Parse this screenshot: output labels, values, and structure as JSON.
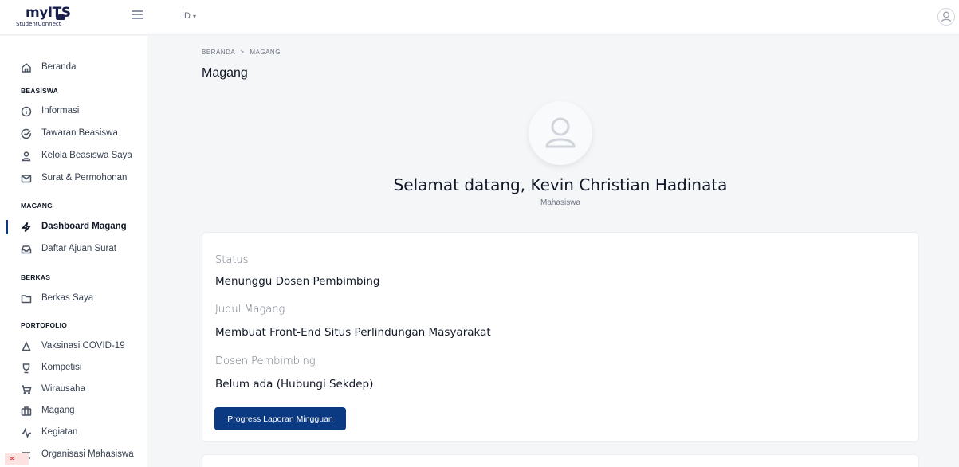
{
  "brand": {
    "name": "myITS",
    "subtitle": "StudentConnect"
  },
  "topbar": {
    "language": "ID",
    "language_caret": "▾"
  },
  "sidebar": {
    "home": {
      "label": "Beranda",
      "icon": "home-icon"
    },
    "sections": {
      "beasiswa": "BEASISWA",
      "magang": "MAGANG",
      "berkas": "BERKAS",
      "portofolio": "PORTOFOLIO"
    },
    "beasiswa_items": [
      {
        "label": "Informasi",
        "icon": "info-icon"
      },
      {
        "label": "Tawaran Beasiswa",
        "icon": "check-circle-icon"
      },
      {
        "label": "Kelola Beasiswa Saya",
        "icon": "user-icon"
      },
      {
        "label": "Surat & Permohonan",
        "icon": "mail-icon"
      }
    ],
    "magang_items": [
      {
        "label": "Dashboard Magang",
        "icon": "lightning-icon",
        "active": true
      },
      {
        "label": "Daftar Ajuan Surat",
        "icon": "inbox-icon"
      }
    ],
    "berkas_items": [
      {
        "label": "Berkas Saya",
        "icon": "folder-icon"
      }
    ],
    "portofolio_items": [
      {
        "label": "Vaksinasi COVID-19",
        "icon": "shield-icon"
      },
      {
        "label": "Kompetisi",
        "icon": "trophy-icon"
      },
      {
        "label": "Wirausaha",
        "icon": "cart-icon"
      },
      {
        "label": "Magang",
        "icon": "building-icon"
      },
      {
        "label": "Kegiatan",
        "icon": "activity-icon"
      },
      {
        "label": "Organisasi Mahasiswa",
        "icon": "organization-icon"
      }
    ]
  },
  "breadcrumb": {
    "home": "BERANDA",
    "separator": ">",
    "current": "MAGANG"
  },
  "page": {
    "title": "Magang"
  },
  "profile": {
    "welcome": "Selamat datang, Kevin Christian Hadinata",
    "role": "Mahasiswa"
  },
  "details": {
    "status_label": "Status",
    "status_value": "Menunggu Dosen Pembimbing",
    "title_label": "Judul Magang",
    "title_value": "Membuat Front-End Situs Perlindungan Masyarakat",
    "advisor_label": "Dosen Pembimbing",
    "advisor_value": "Belum ada (Hubungi Sekdep)",
    "button_label": "Progress Laporan Mingguan"
  },
  "colors": {
    "primary": "#0b3a82",
    "background": "#f5f6f8"
  }
}
